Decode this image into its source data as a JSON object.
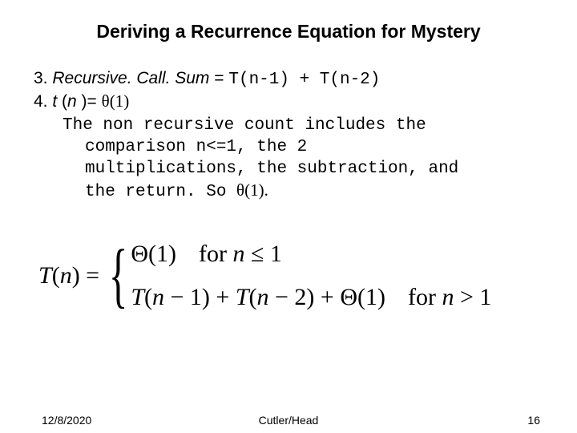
{
  "title": "Deriving a Recurrence Equation for Mystery",
  "line3_prefix": "3. ",
  "line3_label": "Recursive. Call. Sum",
  "line3_eq": " = ",
  "line3_mono": "T(n-1) + T(n-2)",
  "line4_prefix": "4. ",
  "line4_tn": "t ",
  "line4_paren": "(",
  "line4_nvar": "n ",
  "line4_after": ")= ",
  "line4_theta": "θ(1)",
  "expl1": "The non recursive count includes the",
  "expl2": "comparison n<=1, the 2",
  "expl3": "multiplications, the subtraction, and",
  "expl4a": "the return. So ",
  "expl4b": "θ(1).",
  "formula_lhs_T": "T",
  "formula_lhs_paren_open": "(",
  "formula_lhs_n": "n",
  "formula_lhs_paren_close": ") = ",
  "case1_val": "Θ(1)",
  "case1_for": "for ",
  "case1_n": "n ",
  "case1_rel": "≤ 1",
  "case2_T1": "T",
  "case2_p1": "(",
  "case2_n1": "n ",
  "case2_m1": "− 1) + ",
  "case2_T2": "T",
  "case2_p2": "(",
  "case2_n2": "n ",
  "case2_m2": "− 2) + Θ(1)",
  "case2_for": "for ",
  "case2_n3": "n ",
  "case2_rel": "> 1",
  "footer_date": "12/8/2020",
  "footer_author": "Cutler/Head",
  "footer_page": "16"
}
